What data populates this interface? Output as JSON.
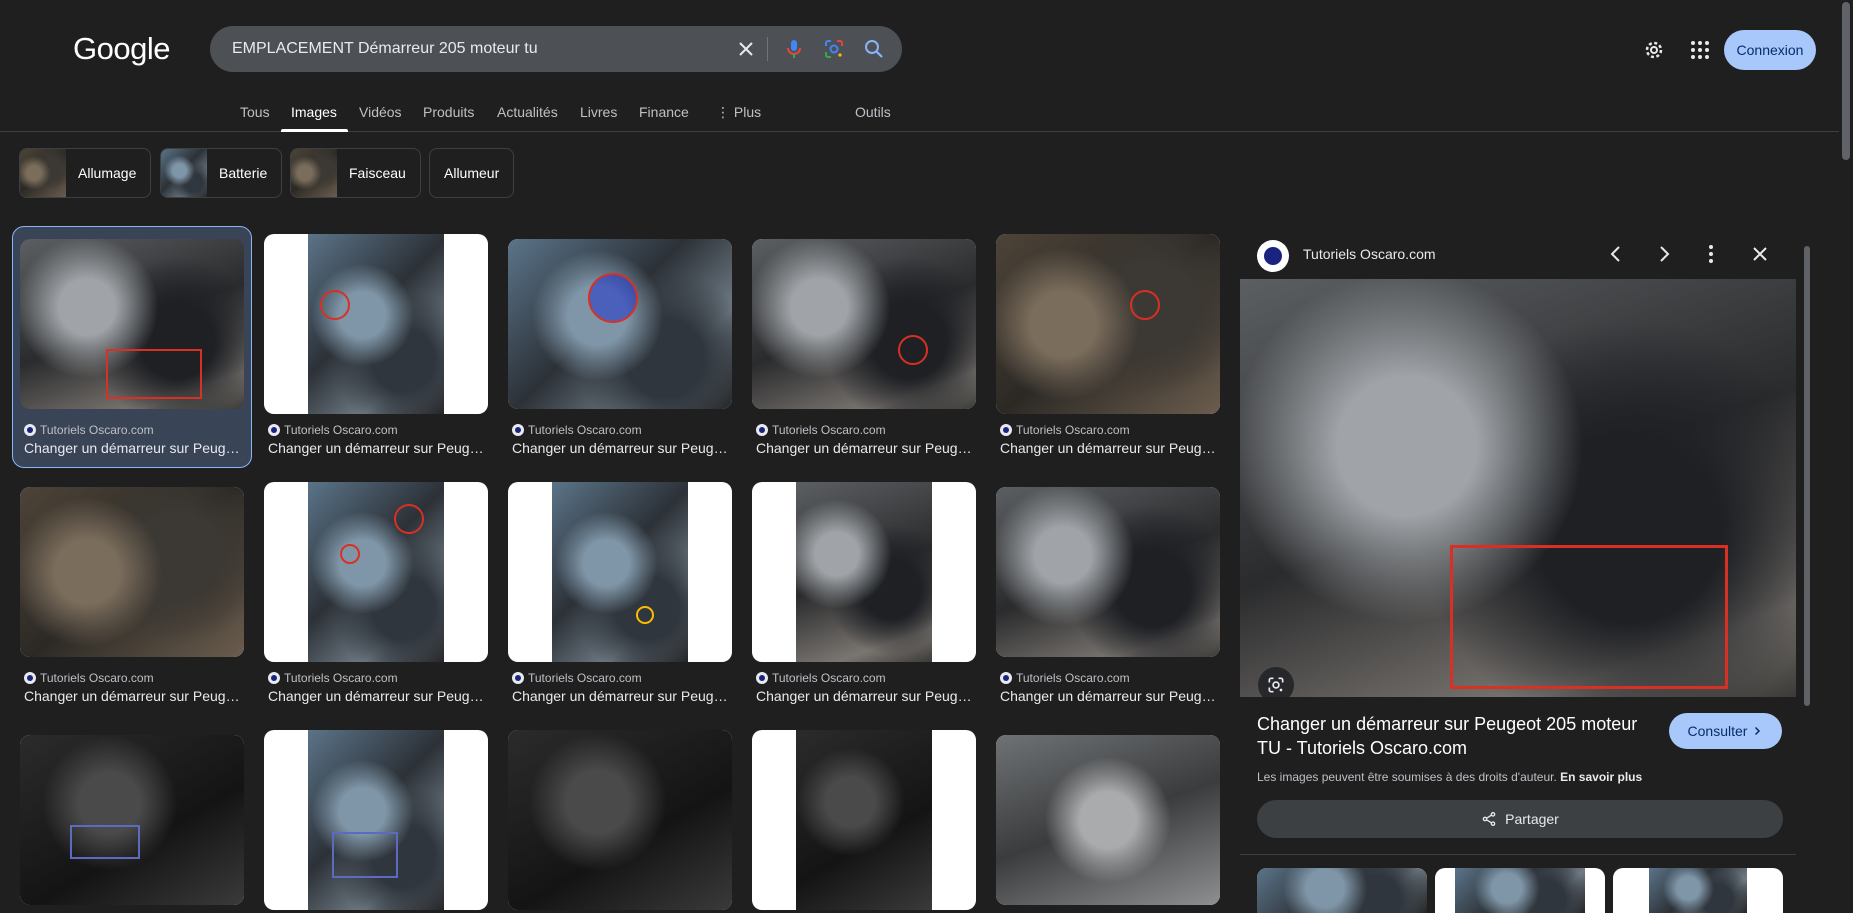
{
  "header": {
    "logo": "Google",
    "search_query": "EMPLACEMENT Démarreur 205 moteur tu",
    "connexion_label": "Connexion"
  },
  "tabs": [
    {
      "label": "Tous"
    },
    {
      "label": "Images"
    },
    {
      "label": "Vidéos"
    },
    {
      "label": "Produits"
    },
    {
      "label": "Actualités"
    },
    {
      "label": "Livres"
    },
    {
      "label": "Finance"
    },
    {
      "label": "⋮ Plus"
    }
  ],
  "tools_label": "Outils",
  "chips": [
    {
      "label": "Allumage"
    },
    {
      "label": "Batterie"
    },
    {
      "label": "Faisceau"
    },
    {
      "label": "Allumeur"
    }
  ],
  "results": {
    "source": "Tutoriels Oscaro.com",
    "title": "Changer un démarreur sur Peugeot 205 moteur TU - Tutoriels Oscaro.com"
  },
  "panel": {
    "site": "Tutoriels Oscaro.com",
    "title": "Changer un démarreur sur Peugeot 205 moteur TU - Tutoriels Oscaro.com",
    "consulter_label": "Consulter",
    "rights_text": "Les images peuvent être soumises à des droits d'auteur.",
    "rights_link": "En savoir plus",
    "share_label": "Partager"
  },
  "colors": {
    "background": "#1f1f1f",
    "accent": "#a8c7fa",
    "selection_border": "#8ab4f8",
    "annotation_red": "#d93025"
  }
}
